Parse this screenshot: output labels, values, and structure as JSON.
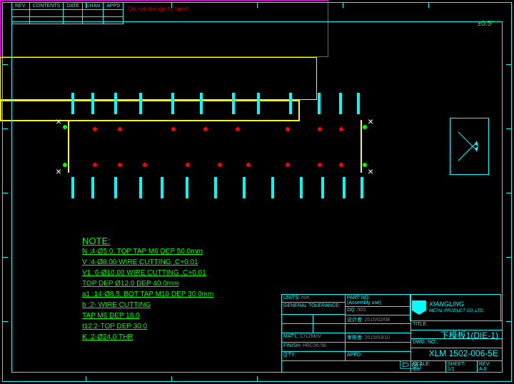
{
  "rev_table": {
    "headers": [
      "REV.",
      "CONTENTS",
      "DATE",
      "CHAN",
      "APPD"
    ]
  },
  "warning": "Do not change by hand!",
  "angle_sym": "±0.5°",
  "notes": {
    "title": "NOTE:",
    "lines": [
      "N :4-Ø5.0, TOP TAP M6 DEP 50.0mm",
      "V :4-Ø8.00 WIRE CUTTING ,C+0.01",
      "V1 :6-Ø10.00 WIRE CUTTING ,C+0.01",
      "  TOP DEP Ø12.0 DEP 40.0mm",
      "a1 :14-Ø8.5, BOT TAP M10 DEP 30.0mm",
      "b  :2- WIRE CUTTING",
      "  TAP M6 DEP 18.0",
      "t12:2-TOP DEP 30.0",
      "K :2-Ø24.0 THR"
    ]
  },
  "title_block": {
    "units_label": "UNITS:",
    "units_value": "mm",
    "tol_label": "GENERAL TOLERANCE:",
    "partno_label": "PART NO.",
    "assy_label": "(Assembly use)",
    "dq": "DQ:",
    "dq_val": "003",
    "title_label": "TITLE:",
    "drawn_label": "设计者:",
    "drawn_date": "2015/02/08",
    "check_label": "审核者:",
    "check_date": "2015/03/10",
    "matl_label": "MAT'L:",
    "matl_value": "Cr12MoV",
    "finish_label": "FINISH:",
    "finish_value": "HRC56-58",
    "qty_label": "Q'TY:",
    "appd_label": "APPD:",
    "dwgno_label": "DWG. NO.:",
    "scale_label": "SCALE:",
    "scale_value": "1:1",
    "sheet_label": "SHEET:",
    "sheet_value": "1/1",
    "rev_label": "REV.",
    "rev_value": "A.0",
    "company_name": "XIANGLING",
    "company_sub": "METAL PRODUCT CO.,LTD.",
    "part_title": "下模板1(DIE-1)",
    "dwg_no": "XLM 1502-006-5E"
  }
}
